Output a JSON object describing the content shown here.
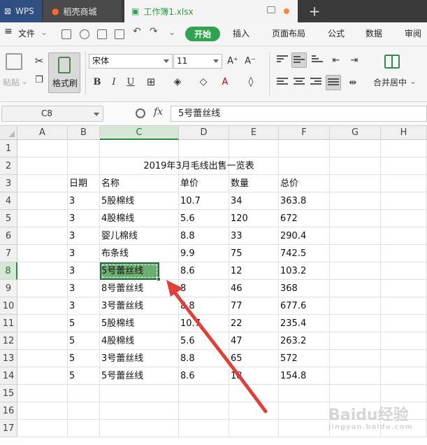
{
  "tabs": {
    "wps": "WPS",
    "store": "稻壳商城",
    "book": "工作簿1.xlsx",
    "add": "+"
  },
  "menu": {
    "file": "文件",
    "start": "开始",
    "insert": "插入",
    "page_layout": "页面布局",
    "formula": "公式",
    "data": "数据",
    "review": "审阅"
  },
  "ribbon": {
    "paste": "粘贴",
    "format_brush": "格式刷",
    "font_name": "宋体",
    "font_size": "11",
    "bold": "B",
    "italic": "I",
    "underline": "U",
    "merge_center": "合并居中"
  },
  "formula_bar": {
    "cell_ref": "C8",
    "fx": "fx",
    "content": "5号蕾丝线"
  },
  "columns": [
    "A",
    "B",
    "C",
    "D",
    "E",
    "F",
    "G",
    "H"
  ],
  "rows": [
    "1",
    "2",
    "3",
    "4",
    "5",
    "6",
    "7",
    "8",
    "9",
    "10",
    "11",
    "12",
    "13",
    "14",
    "15",
    "16",
    "17"
  ],
  "sheet": {
    "title": "2019年3月毛线出售一览表",
    "headers": [
      "日期",
      "名称",
      "单价",
      "数量",
      "总价"
    ],
    "data": [
      [
        "3",
        "5股棉线",
        "10.7",
        "34",
        "363.8"
      ],
      [
        "3",
        "4股棉线",
        "5.6",
        "120",
        "672"
      ],
      [
        "3",
        "婴儿棉线",
        "8.8",
        "33",
        "290.4"
      ],
      [
        "3",
        "布条线",
        "9.9",
        "75",
        "742.5"
      ],
      [
        "3",
        "5号蕾丝线",
        "8.6",
        "12",
        "103.2"
      ],
      [
        "3",
        "8号蕾丝线",
        "8",
        "46",
        "368"
      ],
      [
        "3",
        "3号蕾丝线",
        "8.8",
        "77",
        "677.6"
      ],
      [
        "5",
        "5股棉线",
        "10.7",
        "22",
        "235.4"
      ],
      [
        "5",
        "4股棉线",
        "5.6",
        "47",
        "263.2"
      ],
      [
        "5",
        "3号蕾丝线",
        "8.8",
        "65",
        "572"
      ],
      [
        "5",
        "5号蕾丝线",
        "8.6",
        "18",
        "154.8"
      ]
    ]
  },
  "colors": {
    "accent_green": "#2fa34f",
    "selection_fill": "#6fae73",
    "arrow_red": "#e0403a"
  },
  "watermark": {
    "main": "Baidu经验",
    "sub": "jingyan.baidu.com"
  }
}
